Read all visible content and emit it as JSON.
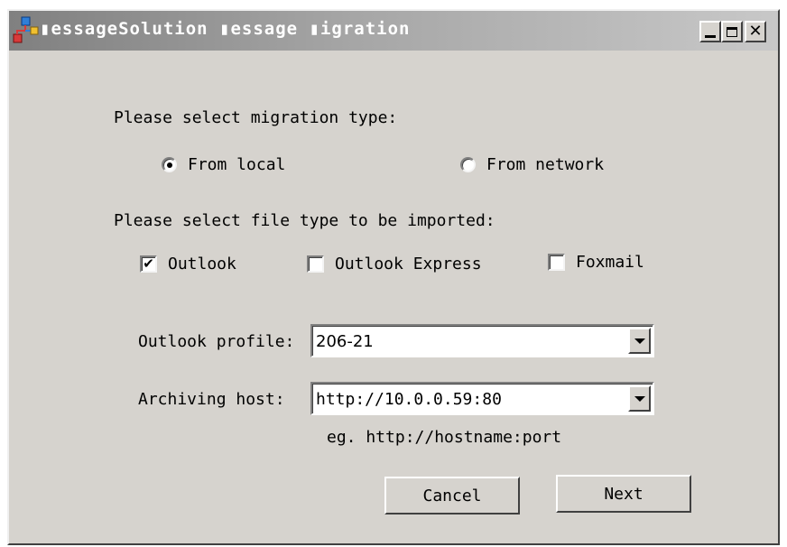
{
  "window": {
    "title": "▮essageSolution ▮essage ▮igration",
    "icon": "app-network-icon",
    "controls": {
      "minimize": "minimize-icon",
      "maximize": "maximize-icon",
      "close": "close-icon",
      "close_glyph": "✕"
    }
  },
  "migration": {
    "prompt": "Please select migration type:",
    "options": [
      {
        "label": "From local",
        "selected": true
      },
      {
        "label": "From network",
        "selected": false
      }
    ]
  },
  "file_types": {
    "prompt": "Please select file type to be imported:",
    "options": [
      {
        "label": "Outlook",
        "checked": true,
        "mark": "✔"
      },
      {
        "label": "Outlook Express",
        "checked": false,
        "mark": ""
      },
      {
        "label": "Foxmail",
        "checked": false,
        "mark": ""
      }
    ]
  },
  "profile": {
    "label": "Outlook profile:",
    "value": "206-21"
  },
  "host": {
    "label": "Archiving host:",
    "value": "http://10.0.0.59:80",
    "hint": "eg. http://hostname:port"
  },
  "buttons": {
    "cancel": "Cancel",
    "next": "Next"
  },
  "colors": {
    "face": "#d6d3ce",
    "title_gradient_start": "#808080",
    "title_gradient_end": "#c8c8c8"
  }
}
